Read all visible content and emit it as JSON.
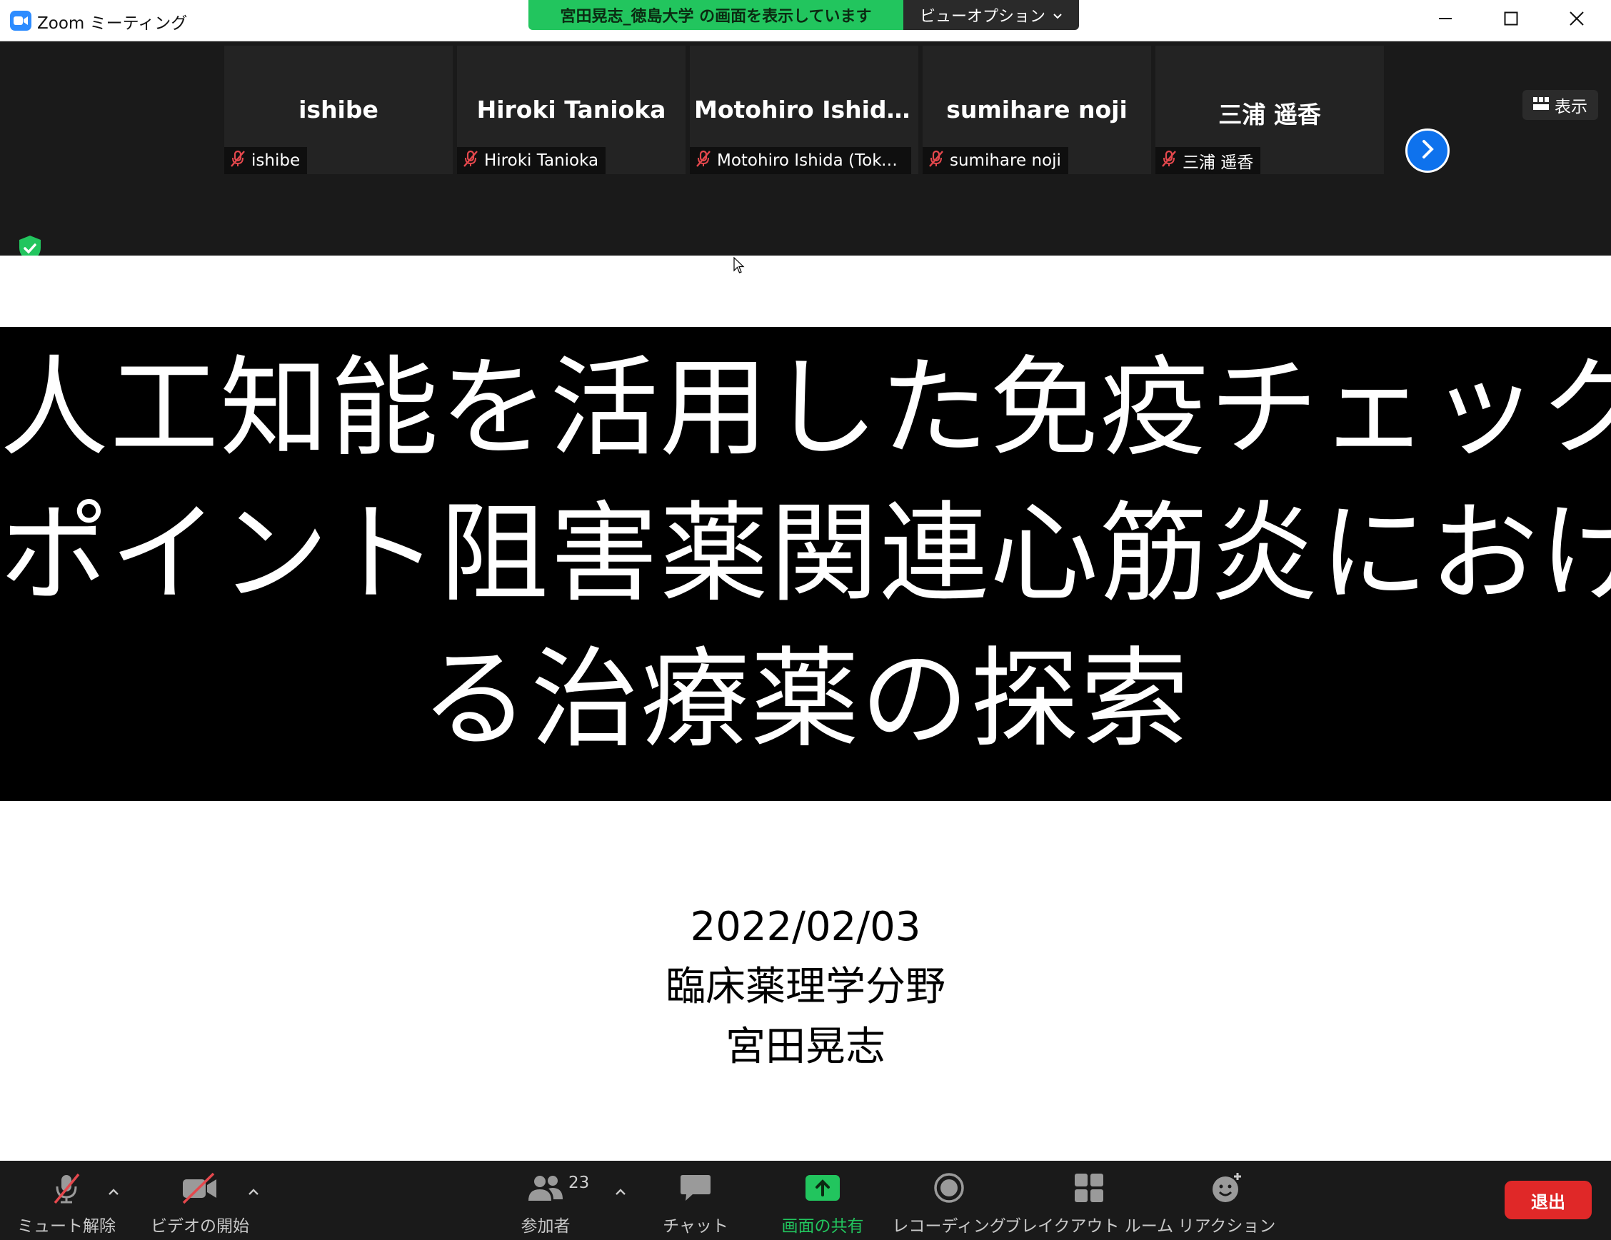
{
  "window": {
    "title": "Zoom ミーティング",
    "share_banner": "宮田晃志_徳島大学 の画面を表示しています",
    "view_options": "ビューオプション"
  },
  "gallery": {
    "tiles": [
      {
        "display_name": "ishibe",
        "label": "ishibe",
        "muted": true
      },
      {
        "display_name": "Hiroki Tanioka",
        "label": "Hiroki Tanioka",
        "muted": true
      },
      {
        "display_name": "Motohiro  Ishida...",
        "label": "Motohiro Ishida (Tokus...",
        "muted": true
      },
      {
        "display_name": "sumihare noji",
        "label": "sumihare noji",
        "muted": true
      },
      {
        "display_name": "三浦 遥香",
        "label": "三浦 遥香",
        "muted": true
      }
    ],
    "view_toggle": "表示"
  },
  "slide": {
    "title_lines": [
      "人工知能を活用した免疫チェック",
      "ポイント阻害薬関連心筋炎におけ",
      "る治療薬の探索"
    ],
    "date": "2022/02/03",
    "department": "臨床薬理学分野",
    "presenter": "宮田晃志"
  },
  "toolbar": {
    "mute": "ミュート解除",
    "video": "ビデオの開始",
    "participants": "参加者",
    "participant_count": "23",
    "chat": "チャット",
    "share": "画面の共有",
    "record": "レコーディング",
    "breakout": "ブレイクアウト ルーム",
    "reactions": "リアクション",
    "leave": "退出"
  },
  "colors": {
    "share_banner": "#22c55e",
    "share_icon": "#22c55e",
    "leave": "#e02828",
    "accent_blue": "#0e72ed",
    "mute_red": "#e5484d"
  },
  "icons": [
    "zoom-logo-icon",
    "chevron-down-icon",
    "minimize-icon",
    "maximize-icon",
    "close-icon",
    "mic-muted-icon",
    "chevron-right-icon",
    "grid-icon",
    "shield-check-icon",
    "mouse-cursor-icon",
    "video-off-icon",
    "caret-up-icon",
    "participants-icon",
    "chat-icon",
    "share-screen-icon",
    "record-icon",
    "breakout-rooms-icon",
    "reactions-icon"
  ]
}
